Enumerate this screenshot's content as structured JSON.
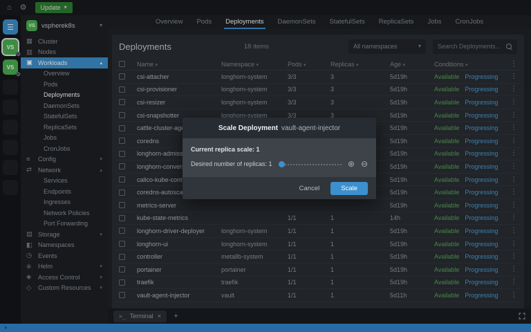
{
  "colors": {
    "accent": "#3d90ce",
    "available": "#5aa75e",
    "progressing": "#4da0dc",
    "update_button": "#2e7d32",
    "cluster_badge": "#4caf50",
    "statusbar": "#3488cf"
  },
  "icons": {
    "home": "⌂",
    "settings": "⚙",
    "kebab": "⋮",
    "plus_circle": "⊕",
    "minus_circle": "⊖",
    "caret_down": "▾",
    "caret_up": "▴",
    "close": "×",
    "add": "+",
    "terminal_prompt": ">_",
    "status_chevrons": "»"
  },
  "topbar": {
    "update_label": "Update"
  },
  "rail": {
    "clusters": [
      {
        "initials": "VS",
        "active": true
      },
      {
        "initials": "VS",
        "active": false
      }
    ],
    "empty_slots": 6
  },
  "sidebar": {
    "cluster": {
      "initials": "VS",
      "name": "vspherek8s"
    },
    "nav": [
      {
        "label": "Cluster",
        "icon": "cluster-icon",
        "glyph": "▦"
      },
      {
        "label": "Nodes",
        "icon": "nodes-icon",
        "glyph": "▥"
      },
      {
        "label": "Workloads",
        "icon": "workloads-icon",
        "glyph": "▣",
        "expanded": true,
        "selected": true,
        "children": [
          {
            "label": "Overview"
          },
          {
            "label": "Pods"
          },
          {
            "label": "Deployments",
            "active": true
          },
          {
            "label": "DaemonSets"
          },
          {
            "label": "StatefulSets"
          },
          {
            "label": "ReplicaSets"
          },
          {
            "label": "Jobs"
          },
          {
            "label": "CronJobs"
          }
        ]
      },
      {
        "label": "Config",
        "icon": "config-icon",
        "glyph": "≡",
        "collapsible": true
      },
      {
        "label": "Network",
        "icon": "network-icon",
        "glyph": "⇄",
        "expanded": true,
        "children": [
          {
            "label": "Services"
          },
          {
            "label": "Endpoints"
          },
          {
            "label": "Ingresses"
          },
          {
            "label": "Network Policies"
          },
          {
            "label": "Port Forwarding"
          }
        ]
      },
      {
        "label": "Storage",
        "icon": "storage-icon",
        "glyph": "▤",
        "collapsible": true
      },
      {
        "label": "Namespaces",
        "icon": "namespaces-icon",
        "glyph": "◧"
      },
      {
        "label": "Events",
        "icon": "events-icon",
        "glyph": "◷"
      },
      {
        "label": "Helm",
        "icon": "helm-icon",
        "glyph": "⎈",
        "collapsible": true
      },
      {
        "label": "Access Control",
        "icon": "access-control-icon",
        "glyph": "◈",
        "collapsible": true
      },
      {
        "label": "Custom Resources",
        "icon": "custom-resources-icon",
        "glyph": "◇",
        "collapsible": true
      }
    ]
  },
  "tabs": {
    "items": [
      {
        "label": "Overview"
      },
      {
        "label": "Pods"
      },
      {
        "label": "Deployments",
        "active": true
      },
      {
        "label": "DaemonSets"
      },
      {
        "label": "StatefulSets"
      },
      {
        "label": "ReplicaSets"
      },
      {
        "label": "Jobs"
      },
      {
        "label": "CronJobs"
      }
    ]
  },
  "header": {
    "title": "Deployments",
    "count": "18 items",
    "namespace_filter": "All namespaces",
    "search_placeholder": "Search Deployments..."
  },
  "table": {
    "columns": [
      "Name",
      "Namespace",
      "Pods",
      "Replicas",
      "Age",
      "Conditions"
    ],
    "rows": [
      {
        "name": "csi-attacher",
        "namespace": "longhorn-system",
        "pods": "3/3",
        "replicas": "3",
        "age": "5d19h",
        "conditions": [
          "Available",
          "Progressing"
        ]
      },
      {
        "name": "csi-provisioner",
        "namespace": "longhorn-system",
        "pods": "3/3",
        "replicas": "3",
        "age": "5d19h",
        "conditions": [
          "Available",
          "Progressing"
        ]
      },
      {
        "name": "csi-resizer",
        "namespace": "longhorn-system",
        "pods": "3/3",
        "replicas": "3",
        "age": "5d19h",
        "conditions": [
          "Available",
          "Progressing"
        ]
      },
      {
        "name": "csi-snapshotter",
        "namespace": "longhorn-system",
        "pods": "3/3",
        "replicas": "3",
        "age": "5d19h",
        "conditions": [
          "Available",
          "Progressing"
        ]
      },
      {
        "name": "cattle-cluster-agent",
        "namespace": "",
        "pods": "",
        "replicas": "",
        "age": "5d19h",
        "conditions": [
          "Available",
          "Progressing"
        ]
      },
      {
        "name": "coredns",
        "namespace": "",
        "pods": "",
        "replicas": "",
        "age": "5d19h",
        "conditions": [
          "Available",
          "Progressing"
        ]
      },
      {
        "name": "longhorn-admission-webh...",
        "namespace": "",
        "pods": "",
        "replicas": "",
        "age": "5d19h",
        "conditions": [
          "Available",
          "Progressing"
        ]
      },
      {
        "name": "longhorn-conversion-web...",
        "namespace": "",
        "pods": "",
        "replicas": "",
        "age": "5d19h",
        "conditions": [
          "Available",
          "Progressing"
        ]
      },
      {
        "name": "calico-kube-controllers",
        "namespace": "",
        "pods": "",
        "replicas": "",
        "age": "5d19h",
        "conditions": [
          "Available",
          "Progressing"
        ]
      },
      {
        "name": "coredns-autoscaler",
        "namespace": "",
        "pods": "",
        "replicas": "",
        "age": "5d19h",
        "conditions": [
          "Available",
          "Progressing"
        ]
      },
      {
        "name": "metrics-server",
        "namespace": "",
        "pods": "",
        "replicas": "",
        "age": "5d19h",
        "conditions": [
          "Available",
          "Progressing"
        ]
      },
      {
        "name": "kube-state-metrics",
        "namespace": "",
        "pods": "1/1",
        "replicas": "1",
        "age": "14h",
        "conditions": [
          "Available",
          "Progressing"
        ]
      },
      {
        "name": "longhorn-driver-deployer",
        "namespace": "longhorn-system",
        "pods": "1/1",
        "replicas": "1",
        "age": "5d19h",
        "conditions": [
          "Available",
          "Progressing"
        ]
      },
      {
        "name": "longhorn-ui",
        "namespace": "longhorn-system",
        "pods": "1/1",
        "replicas": "1",
        "age": "5d19h",
        "conditions": [
          "Available",
          "Progressing"
        ]
      },
      {
        "name": "controller",
        "namespace": "metallb-system",
        "pods": "1/1",
        "replicas": "1",
        "age": "5d19h",
        "conditions": [
          "Available",
          "Progressing"
        ]
      },
      {
        "name": "portainer",
        "namespace": "portainer",
        "pods": "1/1",
        "replicas": "1",
        "age": "5d19h",
        "conditions": [
          "Available",
          "Progressing"
        ]
      },
      {
        "name": "traefik",
        "namespace": "traefik",
        "pods": "1/1",
        "replicas": "1",
        "age": "5d19h",
        "conditions": [
          "Available",
          "Progressing"
        ]
      },
      {
        "name": "vault-agent-injector",
        "namespace": "vault",
        "pods": "1/1",
        "replicas": "1",
        "age": "5d11h",
        "conditions": [
          "Available",
          "Progressing"
        ]
      }
    ]
  },
  "dialog": {
    "title": "Scale Deployment",
    "subject": "vault-agent-injector",
    "current_label": "Current replica scale: 1",
    "desired_label": "Desired number of replicas: 1",
    "slider_value": 1,
    "cancel_label": "Cancel",
    "confirm_label": "Scale"
  },
  "dock": {
    "terminal_label": "Terminal"
  }
}
